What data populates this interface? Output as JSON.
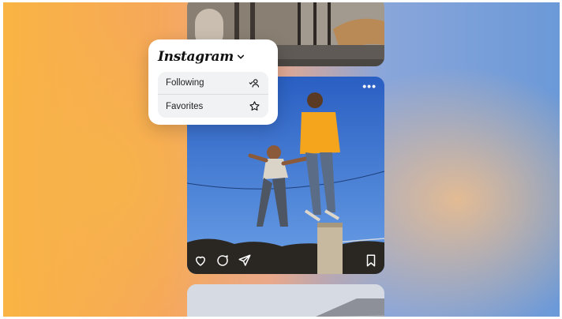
{
  "menu": {
    "brand": "Instagram",
    "items": [
      {
        "label": "Following",
        "icon": "following-icon"
      },
      {
        "label": "Favorites",
        "icon": "star-icon"
      }
    ]
  },
  "post": {
    "more_label": "•••",
    "actions": [
      "heart-icon",
      "comment-icon",
      "share-icon",
      "bookmark-icon"
    ]
  },
  "colors": {
    "menu_bg": "#ffffff",
    "panel_bg": "#f1f2f4",
    "sky": "#3b75d8"
  }
}
